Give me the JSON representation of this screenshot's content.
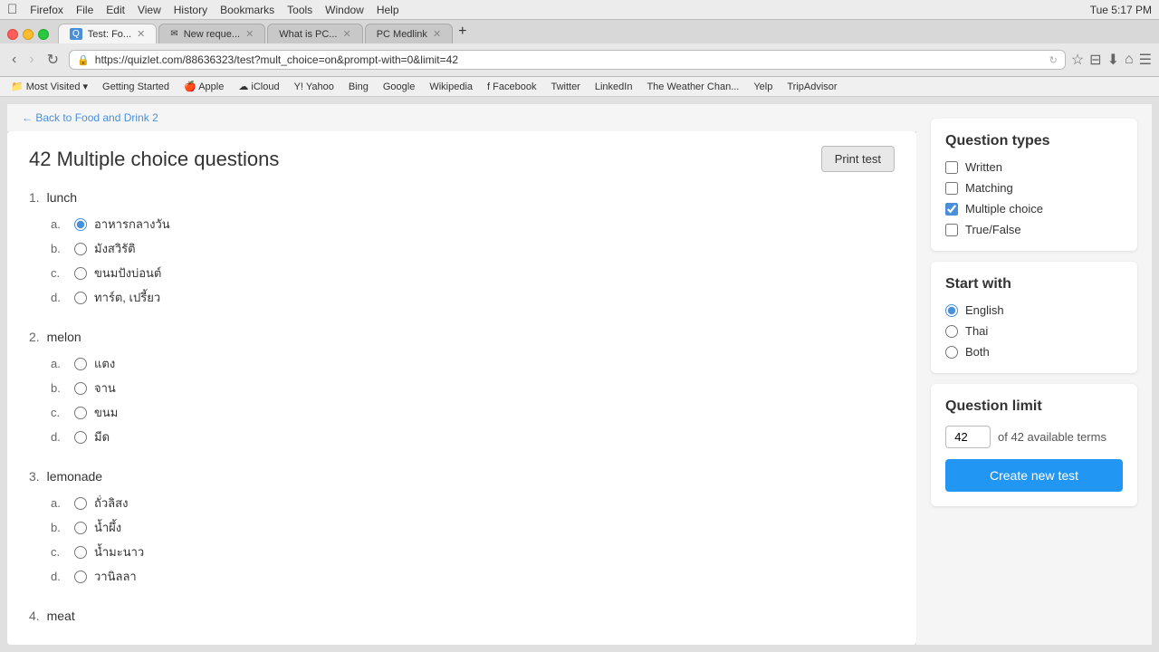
{
  "macmenubar": {
    "apple": "&#63743;",
    "items": [
      "Firefox",
      "File",
      "Edit",
      "View",
      "History",
      "Bookmarks",
      "Tools",
      "Window",
      "Help"
    ],
    "time": "Tue 5:17 PM"
  },
  "browser": {
    "url": "https://quizlet.com/88636323/test?mult_choice=on&prompt-with=0&limit=42",
    "tabs": [
      {
        "label": "Test: Fo...",
        "active": true,
        "favicon": "Q"
      },
      {
        "label": "New reque...",
        "active": false,
        "favicon": "G"
      },
      {
        "label": "What is PC...",
        "active": false,
        "favicon": "W"
      },
      {
        "label": "PC Medlink",
        "active": false,
        "favicon": "P"
      }
    ]
  },
  "bookmarks": [
    "Most Visited",
    "Getting Started",
    "Apple",
    "iCloud",
    "Yahoo",
    "Bing",
    "Google",
    "Wikipedia",
    "Facebook",
    "Twitter",
    "LinkedIn",
    "The Weather Chan...",
    "Yelp",
    "TripAdvisor"
  ],
  "back_link": "← Back to Food and Drink 2",
  "page": {
    "title": "42 Multiple choice questions",
    "print_btn": "Print test"
  },
  "questions": [
    {
      "number": "1.",
      "text": "lunch",
      "answers": [
        {
          "label": "a.",
          "text": "อาหารกลางวัน",
          "selected": true
        },
        {
          "label": "b.",
          "text": "มังสวิรัติ",
          "selected": false
        },
        {
          "label": "c.",
          "text": "ขนมปังบ่อนต์",
          "selected": false
        },
        {
          "label": "d.",
          "text": "ทาร์ต, เปรี้ยว",
          "selected": false
        }
      ]
    },
    {
      "number": "2.",
      "text": "melon",
      "answers": [
        {
          "label": "a.",
          "text": "แตง",
          "selected": false
        },
        {
          "label": "b.",
          "text": "จาน",
          "selected": false
        },
        {
          "label": "c.",
          "text": "ขนม",
          "selected": false
        },
        {
          "label": "d.",
          "text": "มีด",
          "selected": false
        }
      ]
    },
    {
      "number": "3.",
      "text": "lemonade",
      "answers": [
        {
          "label": "a.",
          "text": "ถั่วลิสง",
          "selected": false
        },
        {
          "label": "b.",
          "text": "น้ำผึ้ง",
          "selected": false
        },
        {
          "label": "c.",
          "text": "น้ำมะนาว",
          "selected": false
        },
        {
          "label": "d.",
          "text": "วานิลลา",
          "selected": false
        }
      ]
    },
    {
      "number": "4.",
      "text": "meat",
      "answers": []
    }
  ],
  "sidebar": {
    "question_types": {
      "title": "Question types",
      "options": [
        {
          "label": "Written",
          "checked": false
        },
        {
          "label": "Matching",
          "checked": false
        },
        {
          "label": "Multiple choice",
          "checked": true
        },
        {
          "label": "True/False",
          "checked": false
        }
      ]
    },
    "start_with": {
      "title": "Start with",
      "options": [
        {
          "label": "English",
          "selected": true
        },
        {
          "label": "Thai",
          "selected": false
        },
        {
          "label": "Both",
          "selected": false
        }
      ]
    },
    "question_limit": {
      "title": "Question limit",
      "value": "42",
      "available_text": "of 42 available terms"
    },
    "create_btn": "Create new test"
  }
}
